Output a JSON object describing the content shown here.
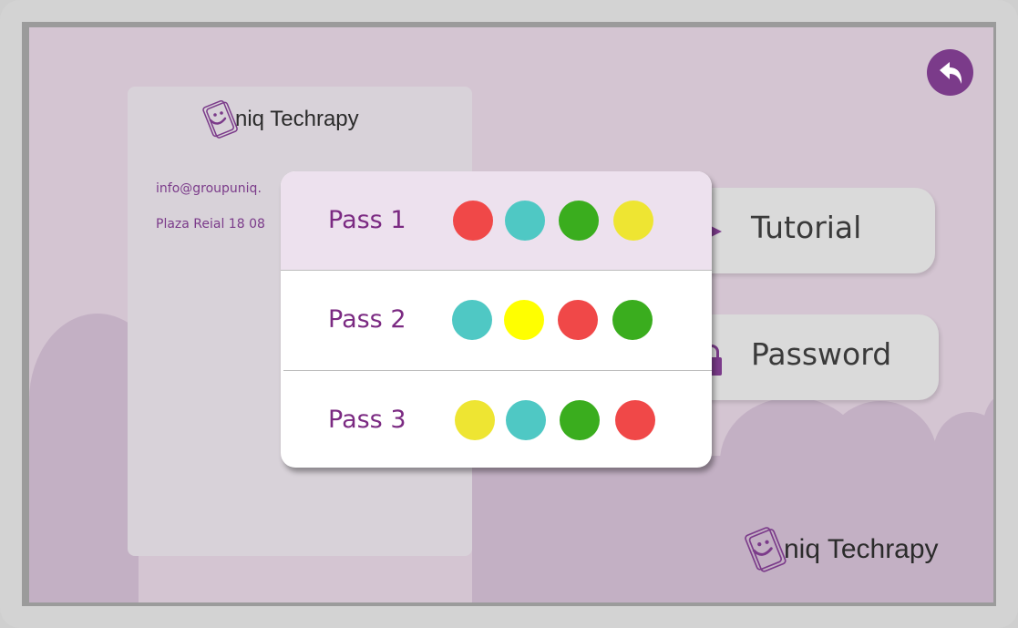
{
  "app": {
    "brand": "niq Techrapy",
    "back_icon": "undo-arrow-icon"
  },
  "info_card": {
    "email": "info@groupuniq.",
    "address": "Plaza Reial 18 08"
  },
  "menu": {
    "tutorial_label": "Tutorial",
    "password_label": "Password"
  },
  "passes": [
    {
      "label": "Pass 1",
      "selected": true,
      "colors": [
        "#f04848",
        "#4fc8c4",
        "#3aad1e",
        "#eee532"
      ]
    },
    {
      "label": "Pass 2",
      "selected": false,
      "colors": [
        "#4fc8c4",
        "#ffff00",
        "#f04848",
        "#3aad1e"
      ]
    },
    {
      "label": "Pass 3",
      "selected": false,
      "colors": [
        "#eee532",
        "#4fc8c4",
        "#3aad1e",
        "#f04848"
      ]
    }
  ],
  "colors": {
    "accent": "#7b3b8a",
    "background": "#d4c5d2",
    "selected_row": "#ede1ee"
  }
}
